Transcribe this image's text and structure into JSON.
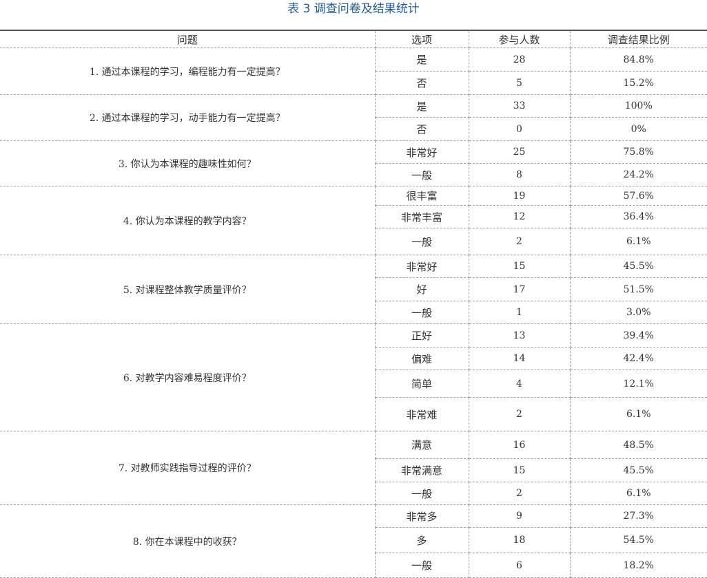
{
  "caption": "表 3 调查问卷及结果统计",
  "headers": {
    "question": "问题",
    "option": "选项",
    "count": "参与人数",
    "ratio": "调查结果比例"
  },
  "questions": [
    {
      "text": "1. 通过本课程的学习，编程能力有一定提高？",
      "rows": [
        {
          "option": "是",
          "count": "28",
          "ratio": "84.8%"
        },
        {
          "option": "否",
          "count": "5",
          "ratio": "15.2%"
        }
      ]
    },
    {
      "text": "2. 通过本课程的学习，动手能力有一定提高？",
      "rows": [
        {
          "option": "是",
          "count": "33",
          "ratio": "100%"
        },
        {
          "option": "否",
          "count": "0",
          "ratio": "0%"
        }
      ]
    },
    {
      "text": "3. 你认为本课程的趣味性如何？",
      "rows": [
        {
          "option": "非常好",
          "count": "25",
          "ratio": "75.8%"
        },
        {
          "option": "一般",
          "count": "8",
          "ratio": "24.2%"
        }
      ]
    },
    {
      "text": "4. 你认为本课程的教学内容？",
      "rows": [
        {
          "option": "很丰富",
          "count": "19",
          "ratio": "57.6%"
        },
        {
          "option": "非常丰富",
          "count": "12",
          "ratio": "36.4%"
        },
        {
          "option": "一般",
          "count": "2",
          "ratio": "6.1%"
        }
      ]
    },
    {
      "text": "5. 对课程整体教学质量评价？",
      "rows": [
        {
          "option": "非常好",
          "count": "15",
          "ratio": "45.5%"
        },
        {
          "option": "好",
          "count": "17",
          "ratio": "51.5%"
        },
        {
          "option": "一般",
          "count": "1",
          "ratio": "3.0%"
        }
      ]
    },
    {
      "text": "6. 对教学内容难易程度评价？",
      "rows": [
        {
          "option": "正好",
          "count": "13",
          "ratio": "39.4%"
        },
        {
          "option": "偏难",
          "count": "14",
          "ratio": "42.4%"
        },
        {
          "option": "简单",
          "count": "4",
          "ratio": "12.1%"
        },
        {
          "option": "非常难",
          "count": "2",
          "ratio": "6.1%"
        }
      ]
    },
    {
      "text": "7. 对教师实践指导过程的评价？",
      "rows": [
        {
          "option": "满意",
          "count": "16",
          "ratio": "48.5%"
        },
        {
          "option": "非常满意",
          "count": "15",
          "ratio": "45.5%"
        },
        {
          "option": "一般",
          "count": "2",
          "ratio": "6.1%"
        }
      ]
    },
    {
      "text": "8. 你在本课程中的收获？",
      "rows": [
        {
          "option": "非常多",
          "count": "9",
          "ratio": "27.3%"
        },
        {
          "option": "多",
          "count": "18",
          "ratio": "54.5%"
        },
        {
          "option": "一般",
          "count": "6",
          "ratio": "18.2%"
        }
      ]
    }
  ]
}
